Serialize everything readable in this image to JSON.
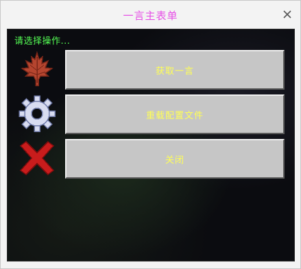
{
  "window": {
    "title": "一言主表单",
    "close_icon": "close-icon"
  },
  "panel": {
    "subtitle": "请选择操作..."
  },
  "buttons": [
    {
      "label": "获取一言",
      "icon": "maple-leaf-icon"
    },
    {
      "label": "重载配置文件",
      "icon": "gear-icon"
    },
    {
      "label": "关闭",
      "icon": "red-x-icon"
    }
  ],
  "colors": {
    "title": "#e64fe6",
    "subtitle": "#55ff55",
    "button_text": "#ffff55",
    "button_bg": "#c6c6c6",
    "panel_bg": "#0b0c10"
  }
}
